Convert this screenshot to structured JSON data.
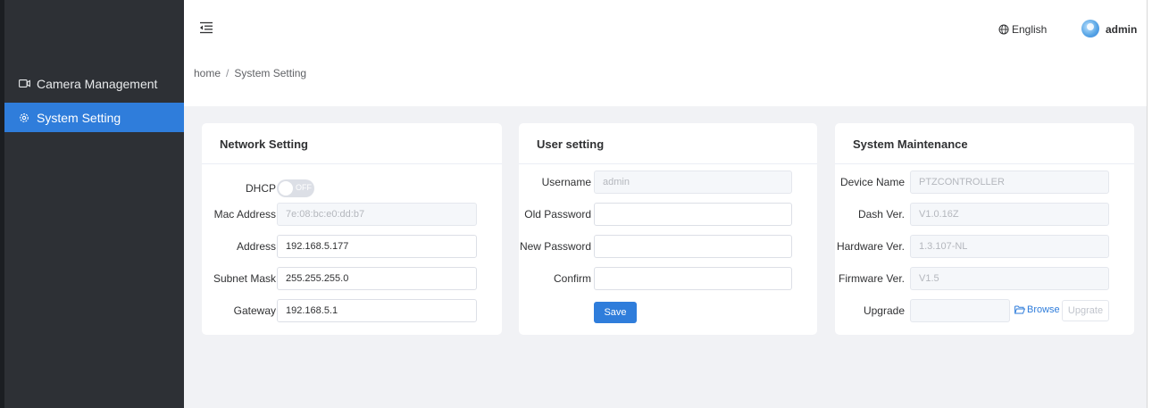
{
  "sidebar": {
    "items": [
      {
        "label": "Camera Management",
        "icon": "camera-icon",
        "active": false
      },
      {
        "label": "System Setting",
        "icon": "gear-icon",
        "active": true
      }
    ]
  },
  "header": {
    "language": "English",
    "user": "admin"
  },
  "breadcrumb": {
    "home": "home",
    "separator": "/",
    "current": "System Setting"
  },
  "network": {
    "title": "Network Setting",
    "dhcp_label": "DHCP",
    "dhcp_state": "OFF",
    "mac_label": "Mac Address",
    "mac_value": "7e:08:bc:e0:dd:b7",
    "address_label": "Address",
    "address_value": "192.168.5.177",
    "subnet_label": "Subnet Mask",
    "subnet_value": "255.255.255.0",
    "gateway_label": "Gateway",
    "gateway_value": "192.168.5.1"
  },
  "user_setting": {
    "title": "User setting",
    "username_label": "Username",
    "username_value": "admin",
    "old_password_label": "Old Password",
    "old_password_value": "",
    "new_password_label": "New Password",
    "new_password_value": "",
    "confirm_label": "Confirm",
    "confirm_value": "",
    "save_label": "Save"
  },
  "maintenance": {
    "title": "System Maintenance",
    "device_name_label": "Device Name",
    "device_name_value": "PTZCONTROLLER",
    "dash_label": "Dash Ver.",
    "dash_value": "V1.0.16Z",
    "hardware_label": "Hardware Ver.",
    "hardware_value": "1.3.107-NL",
    "firmware_label": "Firmware Ver.",
    "firmware_value": "V1.5",
    "upgrade_label": "Upgrade",
    "upgrade_file_value": "",
    "browse_label": "Browse",
    "upgrade_button_label": "Upgrate"
  },
  "colors": {
    "sidebar_bg": "#2d3035",
    "accent": "#2f7ddb",
    "page_bg": "#f1f2f5"
  }
}
